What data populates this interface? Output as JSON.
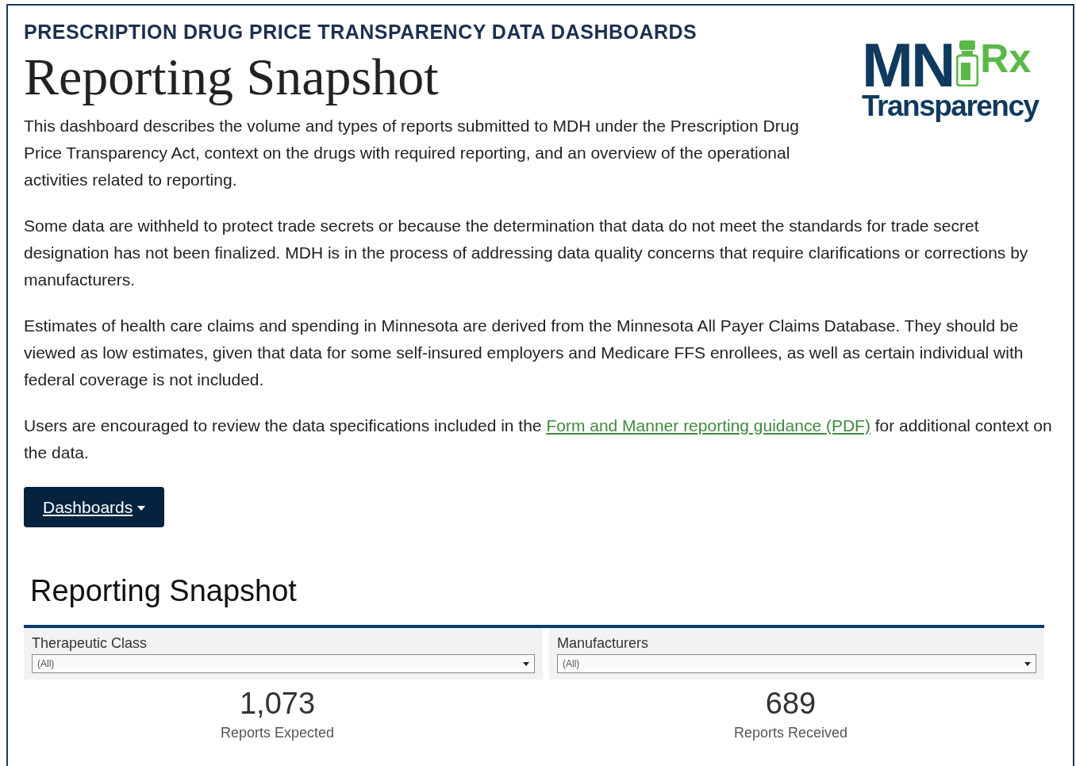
{
  "header": {
    "eyebrow": "PRESCRIPTION DRUG PRICE TRANSPARENCY DATA DASHBOARDS",
    "title": "Reporting Snapshot"
  },
  "logo": {
    "state": "MN",
    "rx": "Rx",
    "word": "Transparency"
  },
  "paragraphs": [
    {
      "parts": [
        {
          "kind": "text",
          "text": "This dashboard describes the volume and types of reports submitted to MDH under the Prescription Drug Price Transparency Act, context on the drugs with required reporting, and an overview of the operational activities related to reporting."
        }
      ]
    },
    {
      "parts": [
        {
          "kind": "text",
          "text": "Some data are withheld to protect trade secrets or because the determination that data do not meet the standards for trade secret designation has not been finalized. MDH is in the process of addressing data quality concerns that require clarifications or corrections by manufacturers."
        }
      ]
    },
    {
      "parts": [
        {
          "kind": "text",
          "text": "Estimates of health care claims and spending in Minnesota are derived from the Minnesota All Payer Claims Database. They should be viewed as low estimates, given that data for some self-insured employers and Medicare FFS enrollees, as well as certain individual with federal coverage is not included."
        }
      ]
    },
    {
      "parts": [
        {
          "kind": "text",
          "text": "Users are encouraged to review the data specifications included in the "
        },
        {
          "kind": "link",
          "text": "Form and Manner reporting guidance (PDF)"
        },
        {
          "kind": "text",
          "text": " for additional context on the data."
        }
      ]
    }
  ],
  "dashboards_button": {
    "label": "Dashboards"
  },
  "dashboard": {
    "title": "Reporting Snapshot",
    "filters": [
      {
        "label": "Therapeutic Class",
        "value": "(All)"
      },
      {
        "label": "Manufacturers",
        "value": "(All)"
      }
    ],
    "kpis": [
      {
        "value": "1,073",
        "label": "Reports Expected"
      },
      {
        "value": "689",
        "label": "Reports Received"
      }
    ]
  }
}
